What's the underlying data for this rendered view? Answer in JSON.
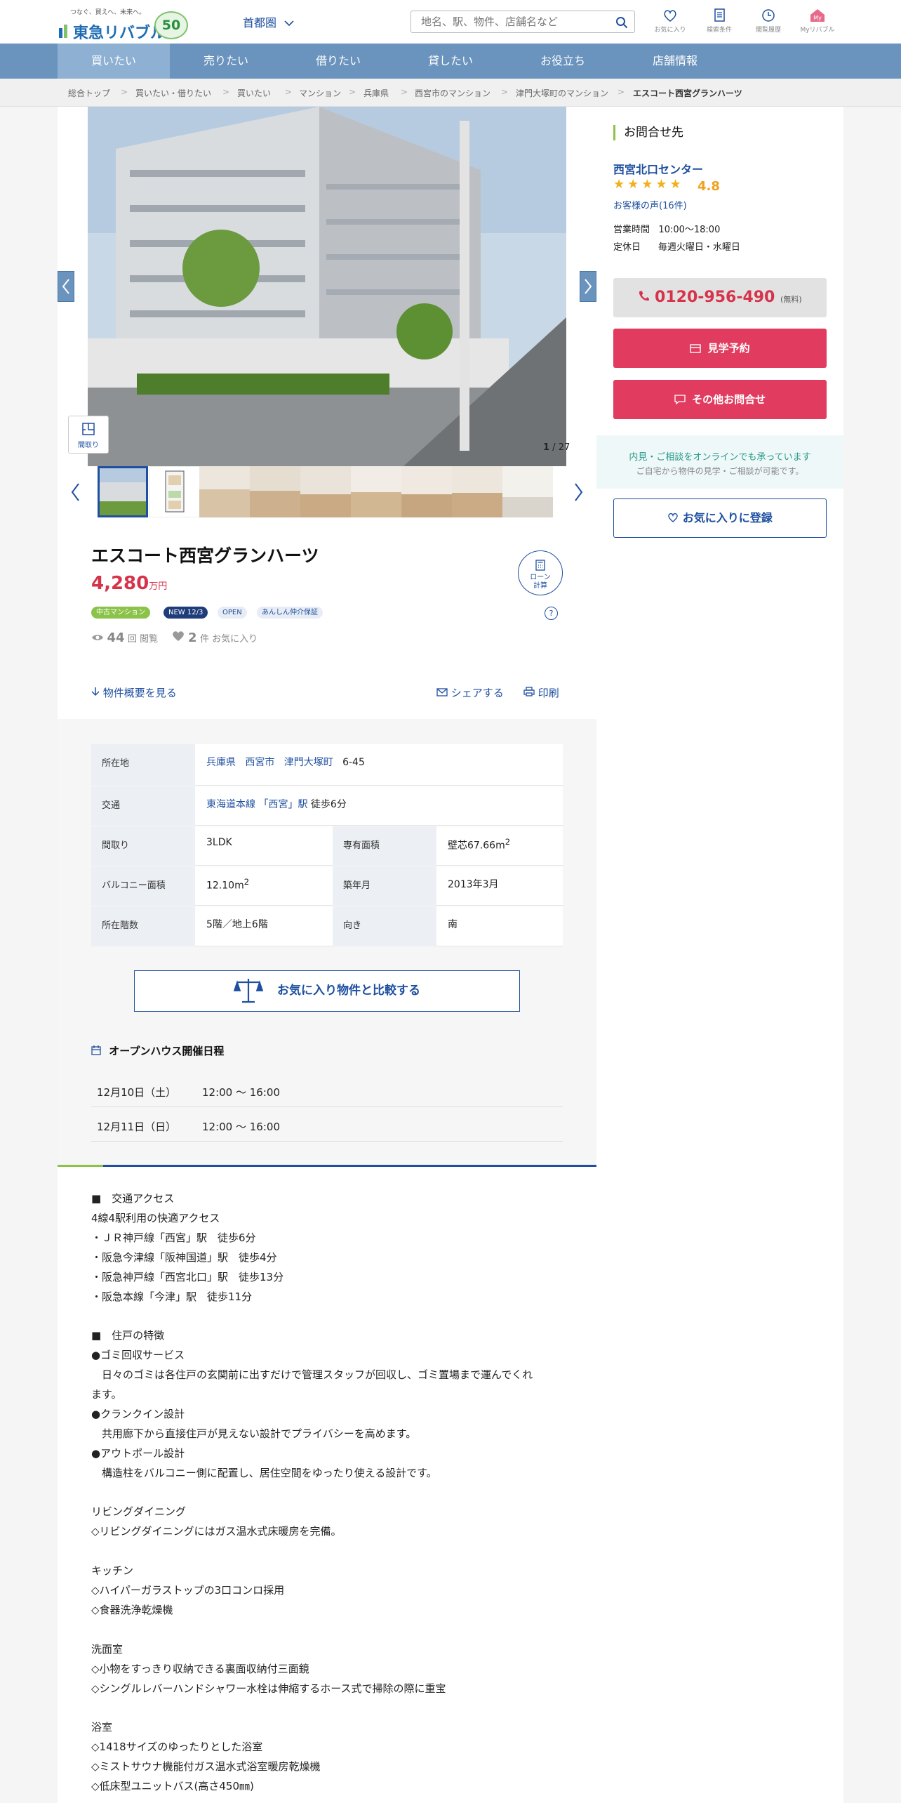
{
  "header": {
    "logo_tagline": "つなぐ、買えへ、未来へ。",
    "logo_text": "東急リバブル",
    "logo_badge": "50",
    "region": "首都圏",
    "search_placeholder": "地名、駅、物件、店舗名など",
    "icons": [
      {
        "label": "お気に入り",
        "icon": "heart-icon"
      },
      {
        "label": "検索条件",
        "icon": "document-icon"
      },
      {
        "label": "閲覧履歴",
        "icon": "clock-icon"
      },
      {
        "label": "Myリバブル",
        "icon": "my-icon"
      }
    ]
  },
  "nav": {
    "items": [
      "買いたい",
      "売りたい",
      "借りたい",
      "貸したい",
      "お役立ち",
      "店舗情報"
    ],
    "active": "買いたい"
  },
  "breadcrumb": [
    "総合トップ",
    "買いたい・借りたい",
    "買いたい",
    "マンション",
    "兵庫県",
    "西宮市のマンション",
    "津門大塚町のマンション",
    "エスコート西宮グランハーツ"
  ],
  "gallery": {
    "floor_label": "間取り",
    "current": "1",
    "total": "27"
  },
  "property": {
    "title": "エスコート西宮グランハーツ",
    "price": "4,280",
    "price_unit": "万円",
    "loan_label_1": "ローン",
    "loan_label_2": "計算",
    "tags": [
      "中古マンション",
      "NEW 12/3",
      "OPEN",
      "あんしん仲介保証"
    ],
    "views": "44",
    "views_label": "回 閲覧",
    "favorites": "2",
    "favorites_label": "件 お気に入り",
    "overview_link": "物件概要を見る",
    "share": "シェアする",
    "print": "印刷"
  },
  "specs": {
    "location_label": "所在地",
    "location_pref": "兵庫県",
    "location_city": "西宮市",
    "location_town": "津門大塚町",
    "location_num": "6-45",
    "traffic_label": "交通",
    "traffic_line": "東海道本線",
    "traffic_station": "「西宮」駅",
    "traffic_walk": "徒歩6分",
    "layout_label": "間取り",
    "layout": "3LDK",
    "area_label": "専有面積",
    "area": "壁芯67.66m",
    "balcony_label": "バルコニー面積",
    "balcony": "12.10m",
    "built_label": "築年月",
    "built": "2013年3月",
    "floor_label": "所在階数",
    "floor": "5階／地上6階",
    "dir_label": "向き",
    "dir": "南",
    "sup": "2"
  },
  "compare_button": "お気に入り物件と比較する",
  "openhouse": {
    "title": "オープンハウス開催日程",
    "rows": [
      {
        "date": "12月10日（土）",
        "time": "12:00 ～ 16:00"
      },
      {
        "date": "12月11日（日）",
        "time": "12:00 ～ 16:00"
      }
    ]
  },
  "description": [
    "■　交通アクセス",
    "4線4駅利用の快適アクセス",
    "・ＪＲ神戸線「西宮」駅　徒歩6分",
    "・阪急今津線「阪神国道」駅　徒歩4分",
    "・阪急神戸線「西宮北口」駅　徒歩13分",
    "・阪急本線「今津」駅　徒歩11分",
    "",
    "■　住戸の特徴",
    "●ゴミ回収サービス",
    "　日々のゴミは各住戸の玄関前に出すだけで管理スタッフが回収し、ゴミ置場まで運んでくれ",
    "ます。",
    "●クランクイン設計",
    "　共用廊下から直接住戸が見えない設計でプライバシーを高めます。",
    "●アウトポール設計",
    "　構造柱をバルコニー側に配置し、居住空間をゆったり使える設計です。",
    "",
    "リビングダイニング",
    "◇リビングダイニングにはガス温水式床暖房を完備。",
    "",
    "キッチン",
    "◇ハイパーガラストップの3口コンロ採用",
    "◇食器洗浄乾燥機",
    "",
    "洗面室",
    "◇小物をすっきり収納できる裏面収納付三面鏡",
    "◇シングルレバーハンドシャワー水栓は伸縮するホース式で掃除の際に重宝",
    "",
    "浴室",
    "◇1418サイズのゆったりとした浴室",
    "◇ミストサウナ機能付ガス温水式浴室暖房乾燥機",
    "◇低床型ユニットバス(高さ450㎜)"
  ],
  "sidebar": {
    "heading": "お問合せ先",
    "shop": "西宮北口センター",
    "rating": "4.8",
    "rating_stars": 5,
    "voice": "お客様の声(16件)",
    "hours_label": "営業時間",
    "hours": "10:00～18:00",
    "holiday_label": "定休日",
    "holiday": "毎週火曜日・水曜日",
    "tel": "0120-956-490",
    "tel_note": "(無料)",
    "visit_button": "見学予約",
    "other_button": "その他お問合せ",
    "online_1": "内見・ご相談をオンラインでも承っています",
    "online_2": "ご自宅から物件の見学・ご相談が可能です。",
    "fav_button": "お気に入りに登録"
  },
  "colors": {
    "brand": "#1e4fa0",
    "nav": "#6a93bd",
    "accent_red": "#e13c5f",
    "price": "#d6334b",
    "green": "#8bc34a"
  }
}
